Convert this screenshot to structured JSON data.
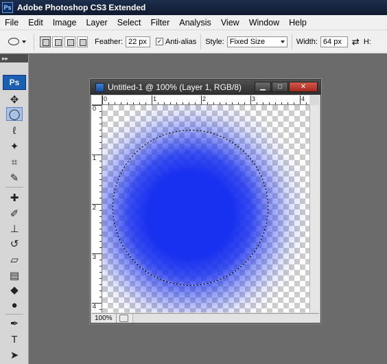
{
  "app": {
    "title": "Adobe Photoshop CS3 Extended",
    "logo": "Ps"
  },
  "menu": [
    "File",
    "Edit",
    "Image",
    "Layer",
    "Select",
    "Filter",
    "Analysis",
    "View",
    "Window",
    "Help"
  ],
  "options": {
    "feather_label": "Feather:",
    "feather_value": "22 px",
    "antialias_label": "Anti-alias",
    "antialias_checked": true,
    "style_label": "Style:",
    "style_value": "Fixed Size",
    "width_label": "Width:",
    "width_value": "64 px",
    "height_label": "H:"
  },
  "toolbox": {
    "logo": "Ps",
    "tools": [
      {
        "name": "move-tool",
        "icon": "move-icon",
        "glyph": "✥"
      },
      {
        "name": "elliptical-marquee-tool",
        "icon": "ellipse-icon",
        "glyph": "◯",
        "active": true
      },
      {
        "name": "lasso-tool",
        "icon": "lasso-icon",
        "glyph": "ℓ"
      },
      {
        "name": "magic-wand-tool",
        "icon": "wand-icon",
        "glyph": "✦"
      },
      {
        "name": "crop-tool",
        "icon": "crop-icon",
        "glyph": "⌗"
      },
      {
        "name": "slice-tool",
        "icon": "slice-icon",
        "glyph": "✎"
      },
      {
        "name": "healing-brush-tool",
        "icon": "bandage-icon",
        "glyph": "✚"
      },
      {
        "name": "brush-tool",
        "icon": "brush-icon",
        "glyph": "✐"
      },
      {
        "name": "clone-stamp-tool",
        "icon": "stamp-icon",
        "glyph": "⊥"
      },
      {
        "name": "history-brush-tool",
        "icon": "history-icon",
        "glyph": "↺"
      },
      {
        "name": "eraser-tool",
        "icon": "eraser-icon",
        "glyph": "▱"
      },
      {
        "name": "gradient-tool",
        "icon": "gradient-icon",
        "glyph": "▤"
      },
      {
        "name": "blur-tool",
        "icon": "drop-icon",
        "glyph": "◆"
      },
      {
        "name": "dodge-tool",
        "icon": "dodge-icon",
        "glyph": "●"
      },
      {
        "name": "pen-tool",
        "icon": "pen-icon",
        "glyph": "✒"
      },
      {
        "name": "type-tool",
        "icon": "type-icon",
        "glyph": "T"
      },
      {
        "name": "path-selection-tool",
        "icon": "arrow-icon",
        "glyph": "➤"
      },
      {
        "name": "shape-tool",
        "icon": "rectangle-icon",
        "glyph": "□"
      }
    ]
  },
  "document": {
    "title": "Untitled-1 @ 100% (Layer 1, RGB/8)",
    "zoom": "100%",
    "ruler_h": [
      "0",
      "1",
      "2",
      "3",
      "4"
    ],
    "ruler_v": [
      "0",
      "1",
      "2",
      "3",
      "4"
    ],
    "window_buttons": {
      "minimize": "▁",
      "maximize": "□",
      "close": "✕"
    }
  },
  "colors": {
    "accent": "#1830f0",
    "title_bar": "#1d2e4c"
  }
}
